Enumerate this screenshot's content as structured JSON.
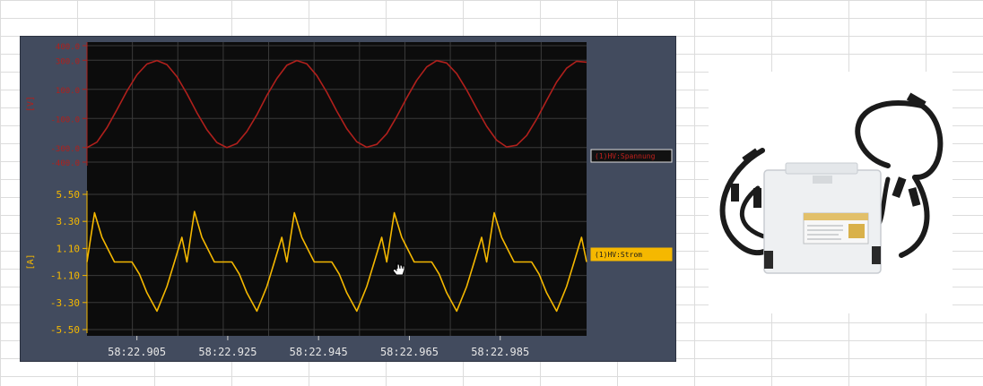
{
  "chart_data": [
    {
      "type": "line",
      "ylabel": "[V]",
      "yticks": [
        "400.0",
        "300.0",
        "100.0",
        "-100.0",
        "-300.0",
        "-400.0"
      ],
      "ylim": [
        -400,
        400
      ],
      "x": [
        0,
        0.002,
        0.004,
        0.006,
        0.008,
        0.01,
        0.012,
        0.014,
        0.016,
        0.018,
        0.02,
        0.022,
        0.024,
        0.026,
        0.028,
        0.03,
        0.032,
        0.034,
        0.036,
        0.038,
        0.04,
        0.042,
        0.044,
        0.046,
        0.048,
        0.05,
        0.052,
        0.054,
        0.056,
        0.058,
        0.06,
        0.062,
        0.064,
        0.066,
        0.068,
        0.07,
        0.072,
        0.074,
        0.076,
        0.078,
        0.08,
        0.082,
        0.084,
        0.086,
        0.088,
        0.09,
        0.092,
        0.094,
        0.096,
        0.098,
        0.1
      ],
      "series": [
        {
          "name": "(1)HV:Spannung",
          "color": "#b0201c",
          "values": [
            -300,
            -263,
            -163,
            -40,
            89,
            200,
            274,
            298,
            270,
            187,
            70,
            -60,
            -178,
            -265,
            -300,
            -272,
            -190,
            -75,
            58,
            175,
            265,
            298,
            275,
            195,
            80,
            -50,
            -170,
            -260,
            -298,
            -278,
            -205,
            -88,
            42,
            162,
            254,
            297,
            281,
            208,
            96,
            -32,
            -154,
            -249,
            -296,
            -284,
            -217,
            -105,
            23,
            150,
            245,
            293,
            287
          ]
        }
      ]
    },
    {
      "type": "line",
      "ylabel": "[A]",
      "yticks": [
        "5.50",
        "3.30",
        "1.10",
        "-1.10",
        "-3.30",
        "-5.50"
      ],
      "ylim": [
        -5.5,
        5.5
      ],
      "xticks": [
        "58:22.905",
        "58:22.925",
        "58:22.945",
        "58:22.965",
        "58:22.985"
      ],
      "x": [
        0,
        0.0015,
        0.003,
        0.0055,
        0.007,
        0.009,
        0.0105,
        0.012,
        0.014,
        0.016,
        0.0175,
        0.019,
        0.02,
        0.0215,
        0.023,
        0.0255,
        0.027,
        0.029,
        0.0305,
        0.032,
        0.034,
        0.036,
        0.0375,
        0.039,
        0.04,
        0.0415,
        0.043,
        0.0455,
        0.047,
        0.049,
        0.0505,
        0.052,
        0.054,
        0.056,
        0.0575,
        0.059,
        0.06,
        0.0615,
        0.063,
        0.0655,
        0.067,
        0.069,
        0.0705,
        0.072,
        0.074,
        0.076,
        0.0775,
        0.079,
        0.08,
        0.0815,
        0.083,
        0.0855,
        0.087,
        0.089,
        0.0905,
        0.092,
        0.094,
        0.096,
        0.0975,
        0.099,
        0.1
      ],
      "series": [
        {
          "name": "(1)HV:Strom",
          "color": "#f5b800",
          "values": [
            0,
            4.0,
            2.0,
            0,
            0,
            0,
            -1.0,
            -2.5,
            -4.0,
            -2.0,
            0,
            2.0,
            0,
            4.1,
            2.0,
            0,
            0,
            0,
            -1.0,
            -2.5,
            -4.0,
            -2.0,
            0,
            2.0,
            0,
            4.0,
            2.0,
            0,
            0,
            0,
            -1.0,
            -2.5,
            -4.0,
            -2.0,
            0,
            2.0,
            0,
            4.0,
            2.0,
            0,
            0,
            0,
            -1.0,
            -2.5,
            -4.0,
            -2.0,
            0,
            2.0,
            0,
            4.0,
            2.0,
            0,
            0,
            0,
            -1.0,
            -2.5,
            -4.0,
            -2.0,
            0,
            2.0,
            0
          ]
        }
      ]
    }
  ]
}
